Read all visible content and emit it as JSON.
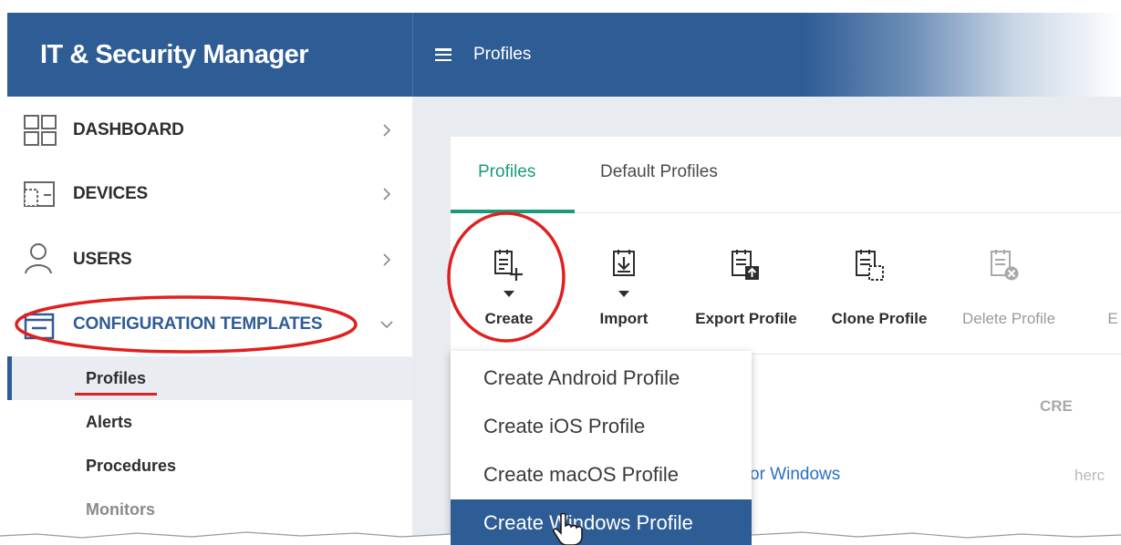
{
  "header": {
    "app_title": "IT & Security Manager",
    "page_title": "Profiles"
  },
  "sidebar": {
    "items": [
      {
        "label": "DASHBOARD",
        "icon": "dashboard-icon"
      },
      {
        "label": "DEVICES",
        "icon": "devices-icon"
      },
      {
        "label": "USERS",
        "icon": "user-icon"
      },
      {
        "label": "CONFIGURATION TEMPLATES",
        "icon": "templates-icon"
      }
    ],
    "subitems": [
      {
        "label": "Profiles",
        "active": true
      },
      {
        "label": "Alerts"
      },
      {
        "label": "Procedures"
      },
      {
        "label": "Monitors"
      }
    ]
  },
  "tabs": [
    {
      "label": "Profiles",
      "active": true
    },
    {
      "label": "Default Profiles"
    }
  ],
  "toolbar": {
    "create": "Create",
    "import": "Import",
    "export": "Export Profile",
    "clone": "Clone Profile",
    "delete": "Delete Profile",
    "cut_off": "E"
  },
  "table": {
    "col_head_partial": "CRE",
    "link_partial": "or Windows",
    "muted_partial": "herc"
  },
  "dropdown": {
    "items": [
      "Create Android Profile",
      "Create iOS Profile",
      "Create macOS Profile",
      "Create Windows Profile"
    ],
    "selected_index": 3
  },
  "colors": {
    "brand_blue": "#2e5c95",
    "tab_green": "#1b9a7a",
    "annotation_red": "#e02020",
    "link_blue": "#2a70c0"
  }
}
